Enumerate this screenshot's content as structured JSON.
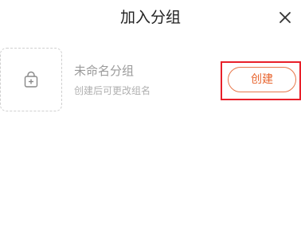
{
  "dialog": {
    "title": "加入分组",
    "close_icon": "close-icon"
  },
  "group": {
    "icon": "lock-plus-icon",
    "name": "未命名分组",
    "hint": "创建后可更改组名",
    "create_label": "创建"
  },
  "colors": {
    "accent": "#e8652f",
    "highlight": "#e8202a",
    "title_text": "#222222",
    "muted_text": "#9a9a9a"
  }
}
